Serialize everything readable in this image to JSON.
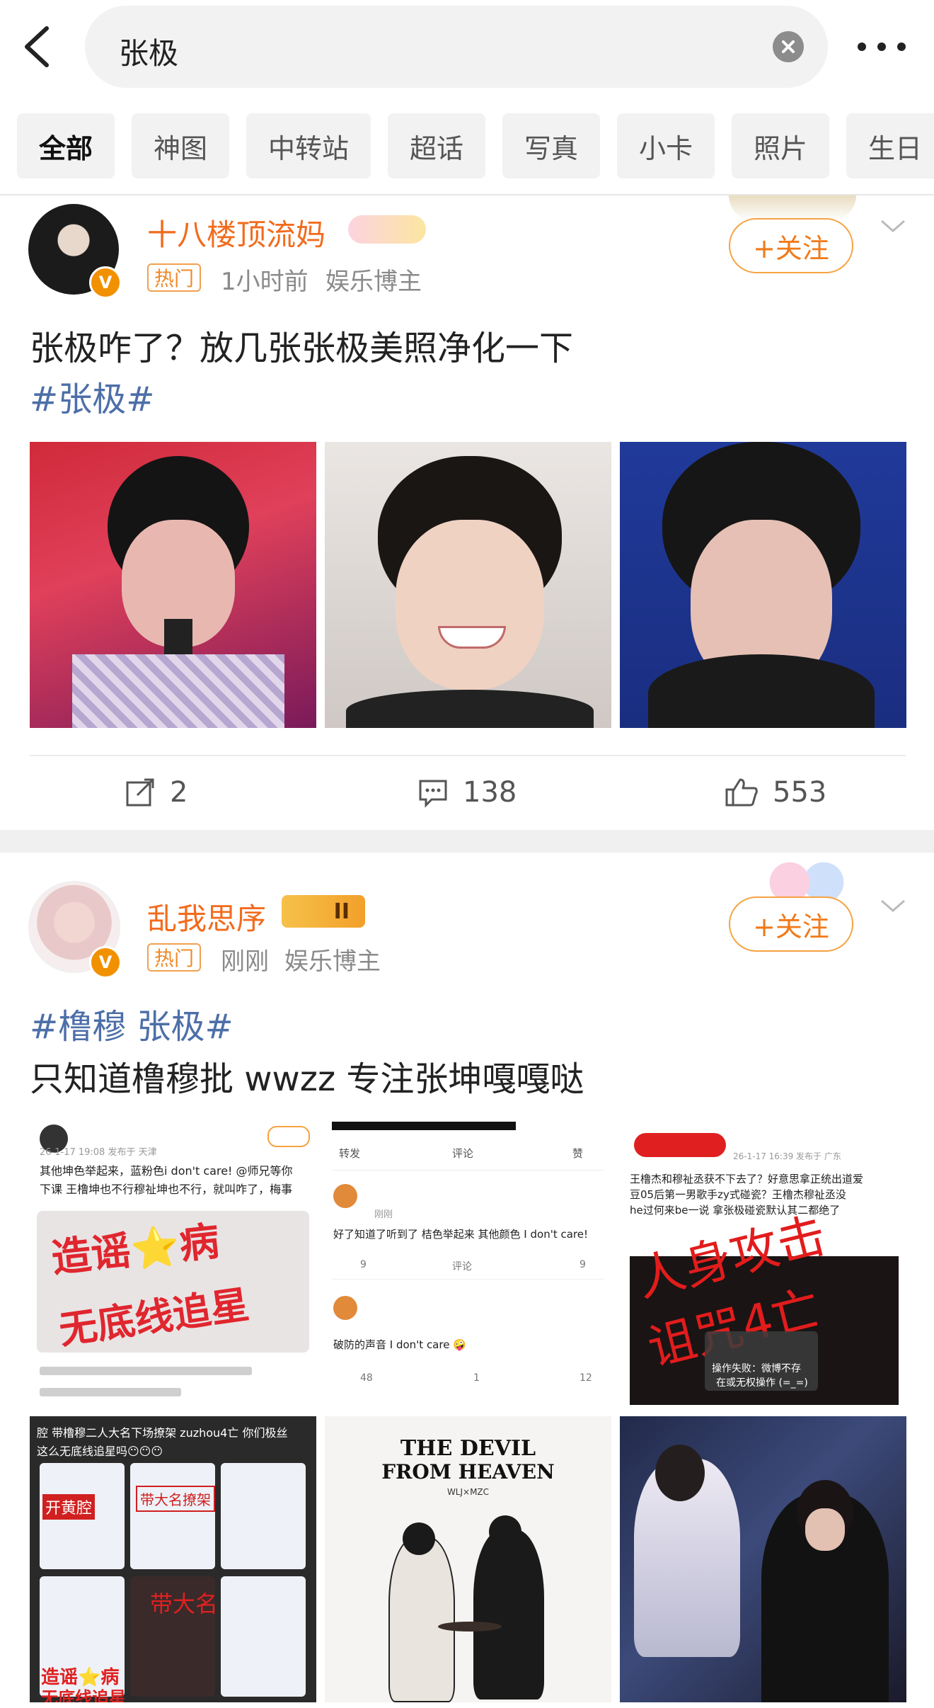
{
  "search": {
    "query": "张极"
  },
  "tabs": [
    "全部",
    "神图",
    "中转站",
    "超话",
    "写真",
    "小卡",
    "照片",
    "生日"
  ],
  "posts": [
    {
      "username": "十八楼顶流妈",
      "hot_label": "热门",
      "time": "1小时前",
      "source": "娱乐博主",
      "follow_label": "+关注",
      "text": "张极咋了？放几张张极美照净化一下",
      "hashtags": "#张极#",
      "actions": {
        "repost": "2",
        "comments": "138",
        "likes": "553"
      }
    },
    {
      "username": "乱我思序",
      "level_badge": "II",
      "hot_label": "热门",
      "time": "刚刚",
      "source": "娱乐博主",
      "follow_label": "+关注",
      "hashtags": "#橹穆 张极#",
      "text": "只知道橹穆批 wwzz 专注张坤嘎嘎哒",
      "images": {
        "img1": {
          "line1": "其他坤色举起来，蓝粉色i don't care! @师兄等你",
          "line2": "下课 王橹坤也不行穆祉坤也不行，就叫咋了，梅事",
          "stamp1": "造谣⭐病",
          "stamp2": "无底线追星",
          "time": "26-1-17 19:08 发布于 天津"
        },
        "img2": {
          "toolbar1": "转发",
          "toolbar2": "评论",
          "toolbar3": "赞",
          "comment1": "好了知道了听到了 桔色举起来 其他颜色 I don't care!",
          "comment2": "破防的声音 I don't care 🤪",
          "n1": "9",
          "n2": "评论",
          "n3": "9",
          "n4": "48",
          "n5": "1",
          "n6": "12",
          "tag": "刚刚"
        },
        "img3": {
          "line1": "王橹杰和穆祉丞获不下去了？好意思拿正统出道爱",
          "line2": "豆05后第一男歌手zy式碰瓷？王橹杰穆祉丞没",
          "line3": "he过何来be一说 拿张极碰瓷默认其二都绝了",
          "stamp1": "人身攻击",
          "stamp2": "诅咒4亡",
          "err1": "操作失败：微博不存",
          "err2": "在或无权操作 (=_=)",
          "time": "26-1-17 16:39 发布于 广东"
        },
        "img4": {
          "line1": "腔 带橹穆二人大名下场撩架 zuzhou4亡 你们极丝",
          "line2": "这么无底线追星吗😶😶😶",
          "s1": "开黄腔",
          "s2": "带大名撩架",
          "s3": "带大名",
          "s4": "造谣⭐病",
          "s5": "无底线追星"
        },
        "img5": {
          "title1": "THE DEVIL",
          "title2": "FROM HEAVEN",
          "sub": "WLJ×MZC"
        }
      }
    }
  ]
}
